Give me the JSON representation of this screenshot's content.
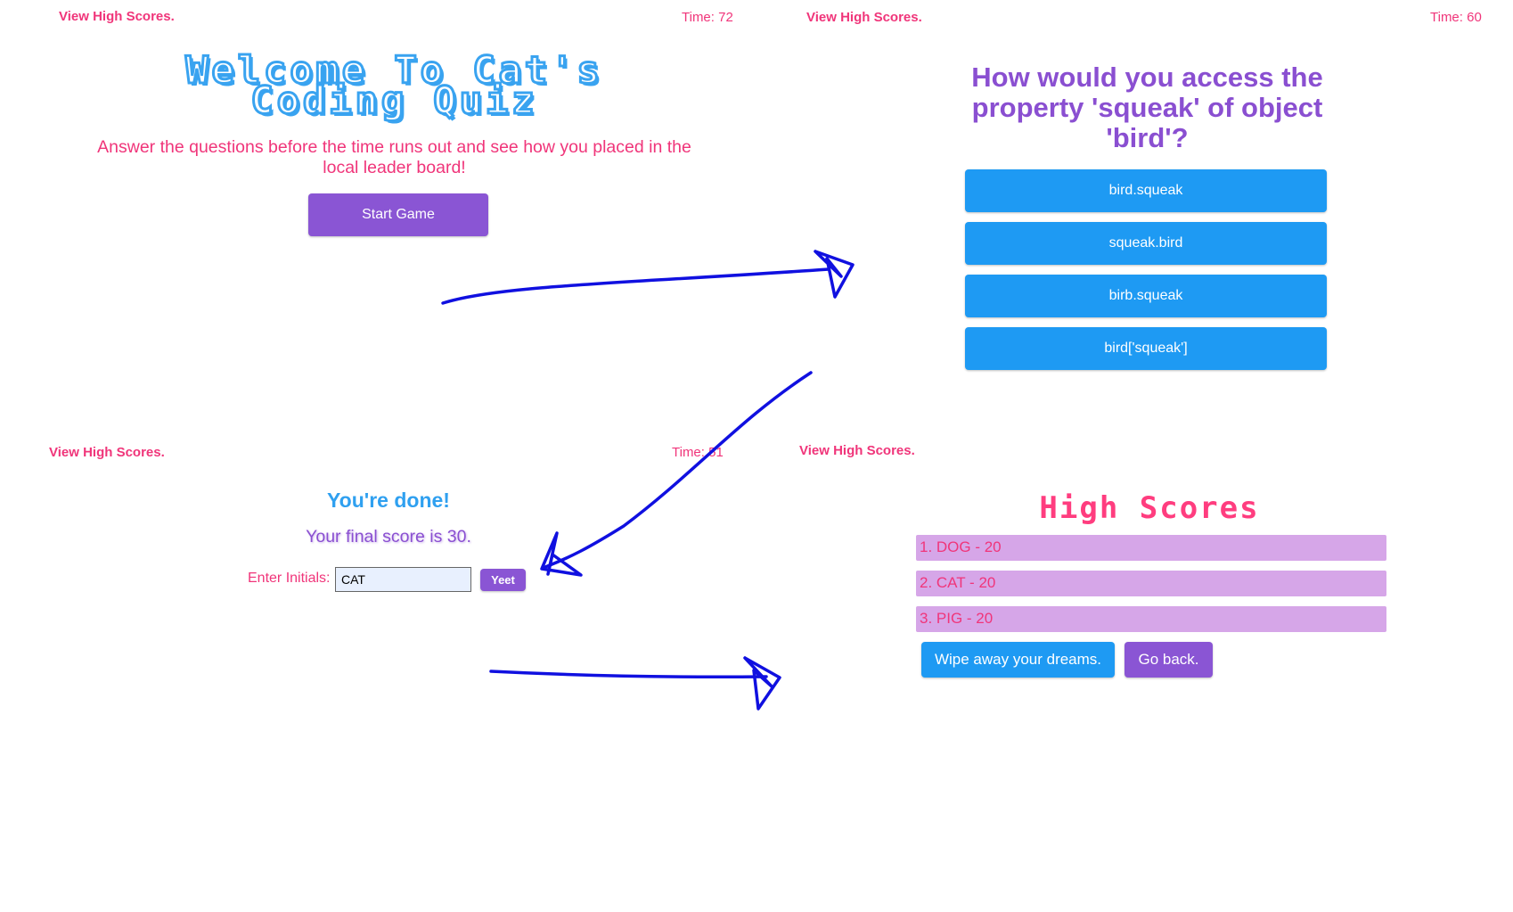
{
  "panel_start": {
    "high_scores_link": "View High Scores.",
    "timer": "Time: 72",
    "title_line1": "Welcome To Cat's",
    "title_line2": "Coding Quiz",
    "intro_text": "Answer the questions before the time runs out and see how you placed in the local leader board!",
    "start_button": "Start Game"
  },
  "panel_question": {
    "high_scores_link": "View High Scores.",
    "timer": "Time: 60",
    "question": "How would you access the property 'squeak' of object 'bird'?",
    "answers": [
      "bird.squeak",
      "squeak.bird",
      "birb.squeak",
      "bird['squeak']"
    ]
  },
  "panel_done": {
    "high_scores_link": "View High Scores.",
    "timer": "Time: 51",
    "title": "You're done!",
    "final_score": "Your final score is 30.",
    "initials_label": "Enter Initials:",
    "initials_value": "CAT",
    "submit_button": "Yeet"
  },
  "panel_highscores": {
    "high_scores_link": "View High Scores.",
    "title": "High Scores",
    "scores": [
      "1. DOG - 20",
      "2. CAT - 20",
      "3. PIG - 20"
    ],
    "clear_button": "Wipe away your dreams.",
    "back_button": "Go back."
  },
  "colors": {
    "pink": "#f0357a",
    "purple": "#8a55d4",
    "blue": "#1e9af3",
    "lavender": "#d6a6e8",
    "arrow": "#1010e0"
  }
}
